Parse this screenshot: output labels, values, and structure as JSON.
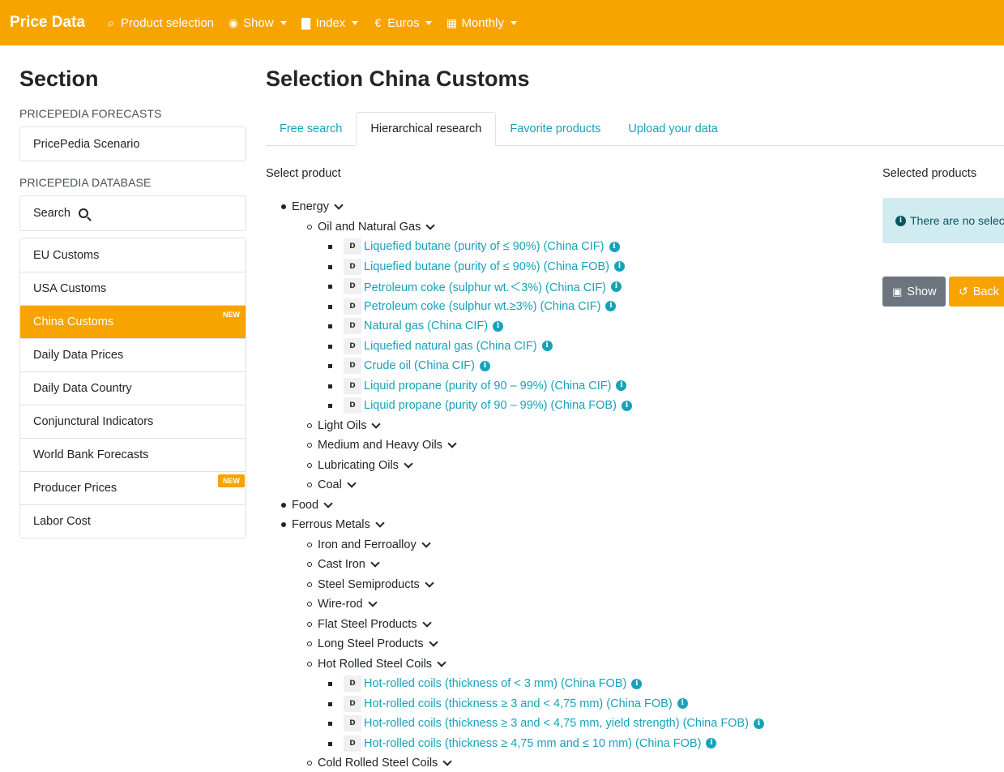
{
  "navbar": {
    "brand": "Price Data",
    "items": [
      {
        "label": "Product selection",
        "icon": "search-icon"
      },
      {
        "label": "Show",
        "icon": "eye-icon"
      },
      {
        "label": "Index",
        "icon": "chart-icon"
      },
      {
        "label": "Euros",
        "icon": "euro-icon"
      },
      {
        "label": "Monthly",
        "icon": "calendar-icon"
      }
    ],
    "color": "#f7a400"
  },
  "sidebar": {
    "title": "Section",
    "forecasts_label": "PRICEPEDIA FORECASTS",
    "forecasts_items": [
      "PricePedia Scenario"
    ],
    "database_label": "PRICEPEDIA DATABASE",
    "search_label": "Search",
    "database_items": [
      {
        "label": "EU Customs",
        "badge": ""
      },
      {
        "label": "USA Customs",
        "badge": ""
      },
      {
        "label": "China Customs",
        "badge": "NEW",
        "active": true
      },
      {
        "label": "Daily Data Prices",
        "badge": ""
      },
      {
        "label": "Daily Data Country",
        "badge": ""
      },
      {
        "label": "Conjunctural Indicators",
        "badge": ""
      },
      {
        "label": "World Bank Forecasts",
        "badge": ""
      },
      {
        "label": "Producer Prices",
        "badge": "NEW"
      },
      {
        "label": "Labor Cost",
        "badge": ""
      }
    ]
  },
  "main": {
    "title": "Selection China Customs",
    "tabs": [
      "Free search",
      "Hierarchical research",
      "Favorite products",
      "Upload your data"
    ],
    "active_tab": "Hierarchical research",
    "select_product_label": "Select product",
    "selected_products_label": "Selected products",
    "alert_text": "There are no selec",
    "show_button": "Show",
    "back_button": "Back"
  },
  "tree": [
    {
      "level": 0,
      "label": "Energy",
      "type": "category"
    },
    {
      "level": 1,
      "label": "Oil and Natural Gas",
      "type": "category"
    },
    {
      "level": 2,
      "label": "Liquefied butane (purity of ≤ 90%) (China CIF)",
      "type": "product"
    },
    {
      "level": 2,
      "label": "Liquefied butane (purity of ≤ 90%) (China FOB)",
      "type": "product"
    },
    {
      "level": 2,
      "label": "Petroleum coke (sulphur wt.＜3%) (China CIF)",
      "type": "product"
    },
    {
      "level": 2,
      "label": "Petroleum coke (sulphur wt.≥3%) (China CIF)",
      "type": "product"
    },
    {
      "level": 2,
      "label": "Natural gas (China CIF)",
      "type": "product"
    },
    {
      "level": 2,
      "label": "Liquefied natural gas (China CIF)",
      "type": "product"
    },
    {
      "level": 2,
      "label": "Crude oil (China CIF)",
      "type": "product"
    },
    {
      "level": 2,
      "label": "Liquid propane (purity of 90 – 99%) (China CIF)",
      "type": "product"
    },
    {
      "level": 2,
      "label": "Liquid propane (purity of 90 – 99%) (China FOB)",
      "type": "product"
    },
    {
      "level": 1,
      "label": "Light Oils",
      "type": "category"
    },
    {
      "level": 1,
      "label": "Medium and Heavy Oils",
      "type": "category"
    },
    {
      "level": 1,
      "label": "Lubricating Oils",
      "type": "category"
    },
    {
      "level": 1,
      "label": "Coal",
      "type": "category"
    },
    {
      "level": 0,
      "label": "Food",
      "type": "category"
    },
    {
      "level": 0,
      "label": "Ferrous Metals",
      "type": "category"
    },
    {
      "level": 1,
      "label": "Iron and Ferroalloy",
      "type": "category"
    },
    {
      "level": 1,
      "label": "Cast Iron",
      "type": "category"
    },
    {
      "level": 1,
      "label": "Steel Semiproducts",
      "type": "category"
    },
    {
      "level": 1,
      "label": "Wire-rod",
      "type": "category"
    },
    {
      "level": 1,
      "label": "Flat Steel Products",
      "type": "category"
    },
    {
      "level": 1,
      "label": "Long Steel Products",
      "type": "category"
    },
    {
      "level": 1,
      "label": "Hot Rolled Steel Coils",
      "type": "category"
    },
    {
      "level": 2,
      "label": "Hot-rolled coils (thickness of < 3 mm) (China FOB)",
      "type": "product"
    },
    {
      "level": 2,
      "label": "Hot-rolled coils (thickness ≥ 3 and < 4,75 mm) (China FOB)",
      "type": "product"
    },
    {
      "level": 2,
      "label": "Hot-rolled coils (thickness ≥ 3 and < 4,75 mm, yield strength) (China FOB)",
      "type": "product"
    },
    {
      "level": 2,
      "label": "Hot-rolled coils (thickness ≥ 4,75 mm and ≤ 10 mm) (China FOB)",
      "type": "product"
    },
    {
      "level": 1,
      "label": "Cold Rolled Steel Coils",
      "type": "category"
    }
  ],
  "product_badge": "D"
}
